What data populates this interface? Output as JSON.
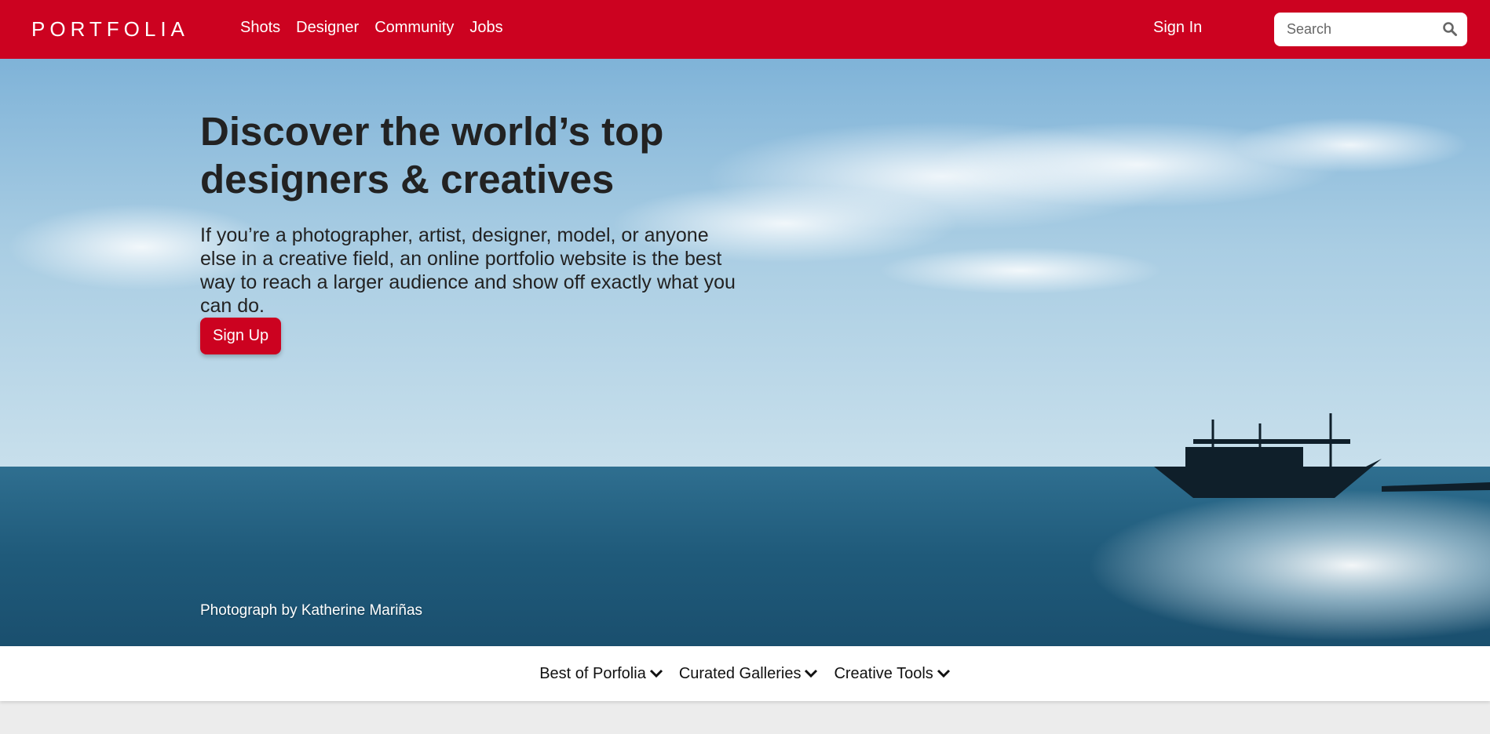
{
  "navbar": {
    "brand": "PORTFOLIA",
    "links": [
      "Shots",
      "Designer",
      "Community",
      "Jobs"
    ],
    "signin_label": "Sign In",
    "search_placeholder": "Search",
    "background_color": "#cc0220"
  },
  "hero": {
    "title": "Discover the world’s top designers & creatives",
    "subtitle": "If you’re a photographer, artist, designer, model, or anyone else in a creative field, an online portfolio website is the best way to reach a larger audience and show off exactly what you can do.",
    "cta_label": "Sign Up",
    "credit": "Photograph by Katherine Mariñas"
  },
  "subnav": {
    "items": [
      "Best of Porfolia",
      "Curated Galleries",
      "Creative Tools"
    ]
  },
  "icons": {
    "search": "search-icon",
    "dropdown": "chevron-down-icon"
  }
}
